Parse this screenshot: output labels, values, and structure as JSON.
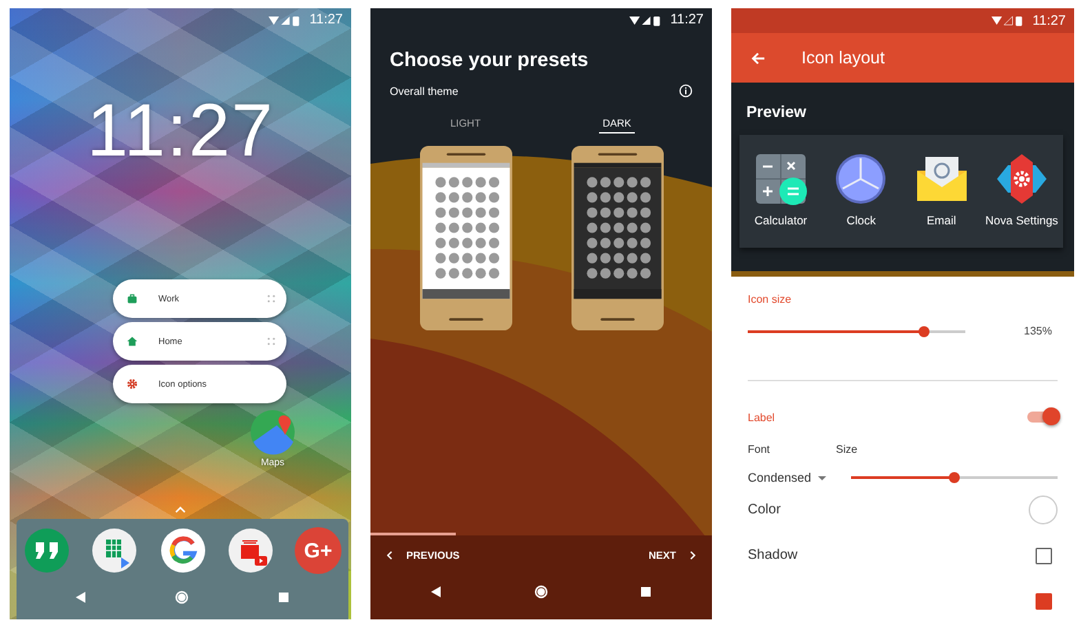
{
  "home_screen": {
    "status_bar": {
      "time": "11:27"
    },
    "clock": "11:27",
    "shortcut_menu": [
      {
        "label": "Work",
        "kind": "work",
        "draggable": true
      },
      {
        "label": "Home",
        "kind": "home",
        "draggable": true
      },
      {
        "label": "Icon options",
        "kind": "options",
        "draggable": false
      }
    ],
    "app": {
      "label": "Maps"
    },
    "dock": [
      {
        "kind": "quote"
      },
      {
        "kind": "sheet"
      },
      {
        "kind": "g"
      },
      {
        "kind": "video"
      },
      {
        "kind": "plus",
        "glyph": "G+"
      }
    ]
  },
  "presets_screen": {
    "status_bar": {
      "time": "11:27"
    },
    "title": "Choose your presets",
    "subtitle": "Overall theme",
    "themes": [
      {
        "label": "LIGHT",
        "kind": "light",
        "selected": false
      },
      {
        "label": "DARK",
        "kind": "dark",
        "selected": true
      }
    ],
    "progress": {
      "level": 0.25
    },
    "previous": "PREVIOUS",
    "next": "NEXT"
  },
  "icon_layout_screen": {
    "status_bar": {
      "time": "11:27"
    },
    "title": "Icon layout",
    "preview": {
      "heading": "Preview",
      "apps": [
        {
          "label": "Calculator",
          "kind": "calculator"
        },
        {
          "label": "Clock",
          "kind": "clock"
        },
        {
          "label": "Email",
          "kind": "email"
        },
        {
          "label": "Nova Settings",
          "kind": "settings"
        }
      ]
    },
    "icon_size": {
      "label": "Icon size",
      "level": 0.81,
      "reading": "135%"
    },
    "label_section": {
      "label": "Label",
      "on": true,
      "font_label": "Font",
      "size_label": "Size",
      "font_value": "Condensed",
      "size_slider": {
        "level": 0.5
      }
    },
    "options": [
      {
        "kind": "color",
        "label": "Color"
      },
      {
        "kind": "checkbox",
        "label": "Shadow",
        "checked": false
      },
      {
        "kind": "checkbox",
        "checked": true
      }
    ]
  }
}
